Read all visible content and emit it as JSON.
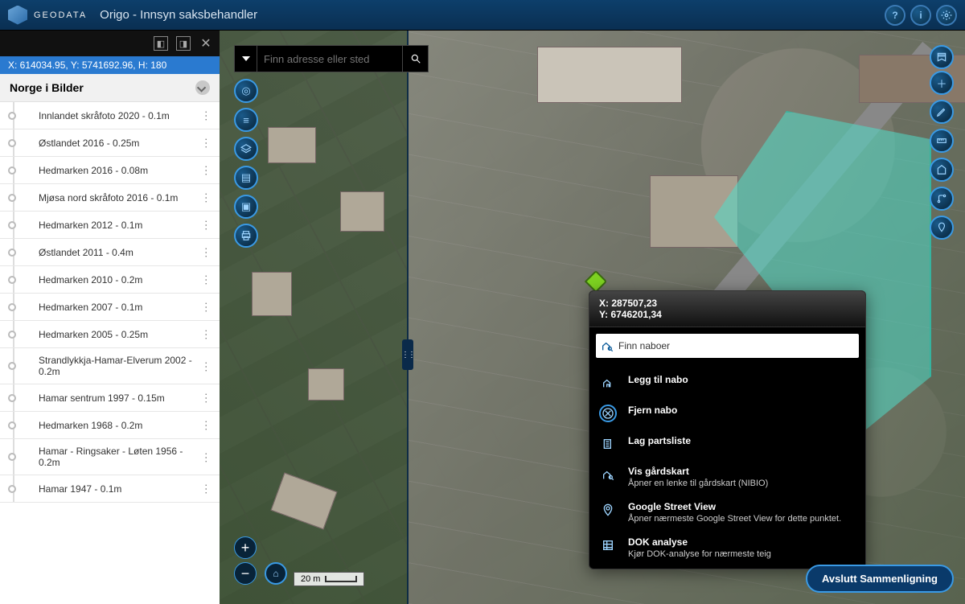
{
  "header": {
    "brand": "GEODATA",
    "title": "Origo - Innsyn saksbehandler"
  },
  "sidebar": {
    "coordinates": "X: 614034.95, Y: 5741692.96, H: 180",
    "section_title": "Norge i Bilder",
    "layers": [
      "Innlandet skråfoto 2020 - 0.1m",
      "Østlandet 2016 - 0.25m",
      "Hedmarken 2016 - 0.08m",
      "Mjøsa nord skråfoto 2016 - 0.1m",
      "Hedmarken 2012 - 0.1m",
      "Østlandet 2011 - 0.4m",
      "Hedmarken 2010 - 0.2m",
      "Hedmarken 2007 - 0.1m",
      "Hedmarken 2005 - 0.25m",
      "Strandlykkja-Hamar-Elverum 2002 - 0.2m",
      "Hamar sentrum 1997 - 0.15m",
      "Hedmarken 1968 - 0.2m",
      "Hamar - Ringsaker - Løten 1956 - 0.2m",
      "Hamar 1947 - 0.1m"
    ]
  },
  "search": {
    "placeholder": "Finn adresse eller sted"
  },
  "scale": {
    "label": "20 m"
  },
  "context": {
    "coord_x": "X: 287507,23",
    "coord_y": "Y: 6746201,34",
    "search_value": "Finn naboer",
    "items": [
      {
        "title": "Legg til nabo",
        "subtitle": ""
      },
      {
        "title": "Fjern nabo",
        "subtitle": ""
      },
      {
        "title": "Lag partsliste",
        "subtitle": ""
      },
      {
        "title": "Vis gårdskart",
        "subtitle": "Åpner en lenke til gårdskart (NIBIO)"
      },
      {
        "title": "Google Street View",
        "subtitle": "Åpner nærmeste Google Street View for dette punktet."
      },
      {
        "title": "DOK analyse",
        "subtitle": "Kjør DOK-analyse for nærmeste teig"
      }
    ]
  },
  "buttons": {
    "finish_compare": "Avslutt Sammenligning"
  }
}
